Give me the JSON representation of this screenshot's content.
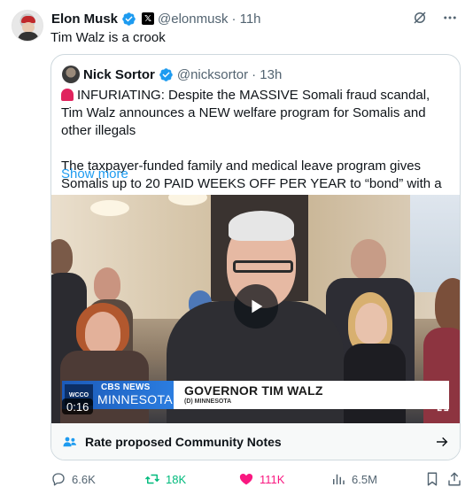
{
  "tweet": {
    "author_name": "Elon Musk",
    "handle": "@elonmusk",
    "time": "· 11h",
    "text": "Tim Walz is a crook"
  },
  "quote": {
    "author_name": "Nick Sortor",
    "handle": "@nicksortor",
    "time": "· 13h",
    "paragraph1": "INFURIATING: Despite the MASSIVE Somali fraud scandal, Tim Walz announces a NEW welfare program for Somalis and other illegals",
    "paragraph2": "The taxpayer-funded family and medical leave program gives Somalis up to 20 PAID WEEKS OFF PER YEAR to “bond” with a  child…",
    "show_more": "Show more",
    "video": {
      "duration": "0:16",
      "network_line1": "CBS NEWS",
      "network_line2": "MINNESOTA",
      "station": "WCCO",
      "chyron_title": "GOVERNOR TIM WALZ",
      "chyron_sub": "(D) MINNESOTA"
    },
    "community_notes_label": "Rate proposed Community Notes"
  },
  "actions": {
    "replies": "6.6K",
    "reposts": "18K",
    "likes": "111K",
    "views": "6.5M"
  },
  "colors": {
    "accent": "#1d9bf0",
    "repost": "#00ba7c",
    "like": "#f91880",
    "muted": "#536471",
    "border": "#cfd9de"
  },
  "icons": [
    "verified-badge-icon",
    "x-affiliate-icon",
    "grok-icon",
    "more-icon",
    "siren-icon",
    "play-icon",
    "expand-icon",
    "community-notes-icon",
    "arrow-right-icon",
    "reply-icon",
    "repost-icon",
    "like-icon",
    "views-icon",
    "bookmark-icon",
    "share-icon"
  ]
}
